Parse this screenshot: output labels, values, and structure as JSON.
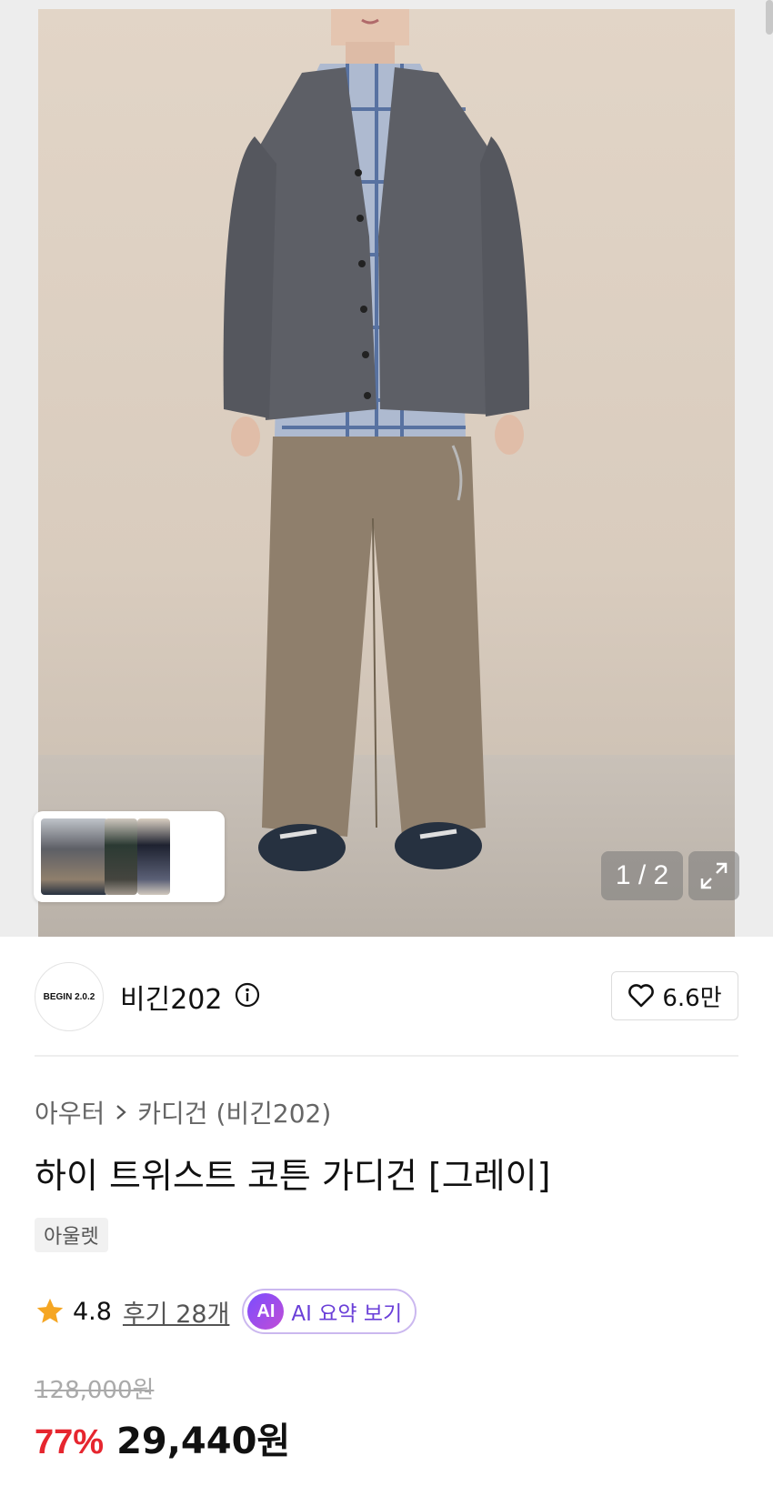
{
  "gallery": {
    "counter": "1 / 2",
    "thumbnails": [
      "outfit-thumb-1",
      "outfit-thumb-2",
      "outfit-thumb-3"
    ]
  },
  "brand": {
    "logo_text": "BEGIN 2.0.2",
    "name": "비긴202",
    "likes": "6.6만"
  },
  "breadcrumb": {
    "category": "아우터",
    "subcategory": "카디건 (비긴202)"
  },
  "product": {
    "title": "하이 트위스트 코튼 가디건 [그레이]",
    "tag": "아울렛",
    "rating": "4.8",
    "review_link": "후기 28개",
    "ai_badge": "AI",
    "ai_label": "AI 요약 보기",
    "original_price": "128,000원",
    "discount": "77%",
    "sale_price": "29,440원"
  },
  "colors": {
    "accent_red": "#e6262f",
    "ai_purple": "#6a3fd8",
    "star": "#f5a623"
  }
}
